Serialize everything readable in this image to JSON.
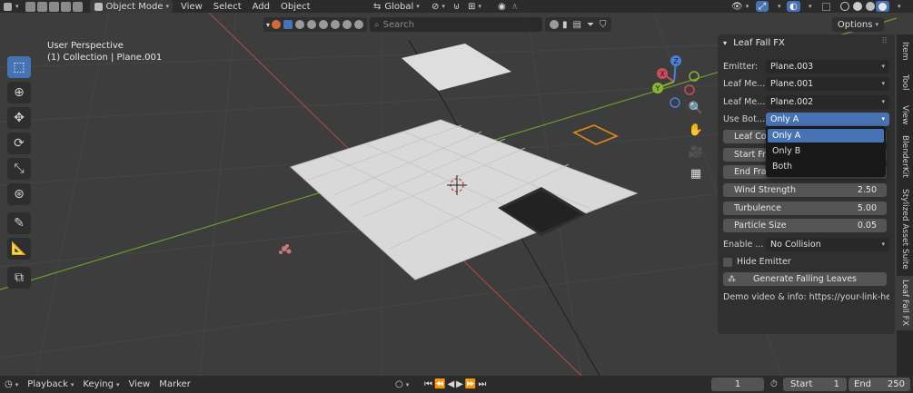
{
  "header": {
    "mode": "Object Mode",
    "menus": [
      "View",
      "Select",
      "Add",
      "Object"
    ],
    "transform_orientation": "Global"
  },
  "viewport": {
    "search_placeholder": "Search",
    "options_label": "Options",
    "perspective": "User Perspective",
    "collection_line": "(1) Collection | Plane.001"
  },
  "panel": {
    "title": "Leaf Fall FX",
    "emitter_label": "Emitter:",
    "emitter_value": "Plane.003",
    "leaf_mesh_a_label": "Leaf Me...",
    "leaf_mesh_a_value": "Plane.001",
    "leaf_mesh_b_label": "Leaf Me...",
    "leaf_mesh_b_value": "Plane.002",
    "use_both_label": "Use Bot...",
    "use_both_value": "Only A",
    "leaf_count_label": "Leaf Co",
    "start_frame_label": "Start Fr",
    "end_frame_label": "End Fra",
    "wind_strength_label": "Wind Strength",
    "wind_strength_value": "2.50",
    "turbulence_label": "Turbulence",
    "turbulence_value": "5.00",
    "particle_size_label": "Particle Size",
    "particle_size_value": "0.05",
    "enable_label": "Enable ...",
    "enable_value": "No Collision",
    "hide_emitter_label": "Hide Emitter",
    "generate_label": "Generate Falling Leaves",
    "info_text": "Demo video & info: https://your-link-her..."
  },
  "dropdown": {
    "options": [
      "Only A",
      "Only B",
      "Both"
    ],
    "selected": "Only A"
  },
  "side_tabs": [
    "Item",
    "Tool",
    "View",
    "BlenderKit",
    "Stylized Asset Suite",
    "Leaf Fall FX"
  ],
  "timeline": {
    "menus": [
      "Playback",
      "Keying",
      "View",
      "Marker"
    ],
    "current_frame": "1",
    "start_label": "Start",
    "start_value": "1",
    "end_label": "End",
    "end_value": "250"
  },
  "colors": {
    "accent": "#4772b3",
    "x_axis": "#b34a4a",
    "y_axis": "#6f9a2e",
    "selection": "#e38a12"
  }
}
